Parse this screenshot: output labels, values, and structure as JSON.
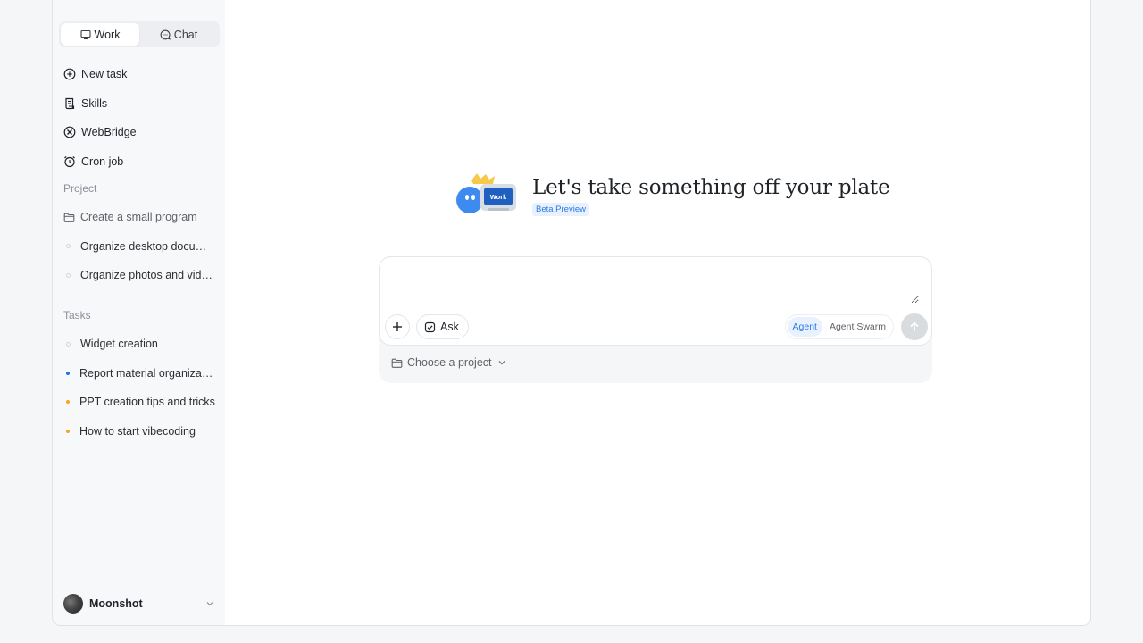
{
  "sidebar": {
    "mode_tabs": [
      {
        "label": "Work",
        "icon": "monitor-icon",
        "active": true
      },
      {
        "label": "Chat",
        "icon": "chat-bubble-icon",
        "active": false
      }
    ],
    "nav": [
      {
        "label": "New task",
        "icon": "plus-circle-icon"
      },
      {
        "label": "Skills",
        "icon": "scroll-icon"
      },
      {
        "label": "WebBridge",
        "icon": "webbridge-icon"
      },
      {
        "label": "Cron job",
        "icon": "alarm-clock-icon"
      }
    ],
    "project_label": "Project",
    "projects": [
      {
        "label": "Create a small program",
        "icon": "folder-icon"
      },
      {
        "label": "Organize desktop documents",
        "status": "hollow"
      },
      {
        "label": "Organize photos and videos",
        "status": "hollow"
      }
    ],
    "tasks_label": "Tasks",
    "tasks": [
      {
        "label": "Widget creation",
        "status": "hollow"
      },
      {
        "label": "Report material organization",
        "status": "blue"
      },
      {
        "label": "PPT creation tips and tricks",
        "status": "orange"
      },
      {
        "label": "How to start vibecoding",
        "status": "orange"
      }
    ],
    "user": {
      "name": "Moonshot"
    }
  },
  "hero": {
    "title": "Let's take something off your plate",
    "badge": "Beta Preview",
    "mascot_label": "Work"
  },
  "composer": {
    "placeholder": "",
    "ask_label": "Ask",
    "modes": [
      {
        "label": "Agent",
        "active": true
      },
      {
        "label": "Agent Swarm",
        "active": false
      }
    ],
    "project_picker": "Choose a project"
  },
  "colors": {
    "accent": "#2c7be5",
    "status_blue": "#1a73e8",
    "status_orange": "#f5a623"
  }
}
